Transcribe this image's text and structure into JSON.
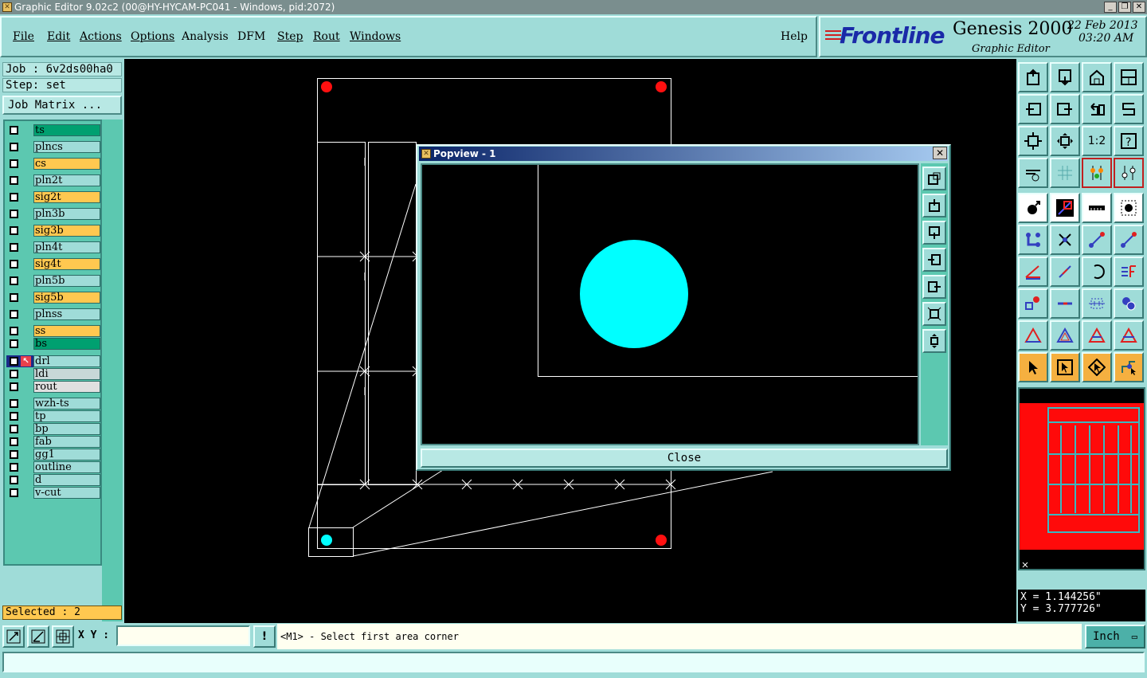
{
  "window": {
    "title": "Graphic Editor 9.02c2 (00@HY-HYCAM-PC041 - Windows, pid:2072)"
  },
  "menu": [
    "File",
    "Edit",
    "Actions",
    "Options",
    "Analysis",
    "DFM",
    "Step",
    "Rout",
    "Windows"
  ],
  "help": "Help",
  "brand": {
    "logo": "Frontline",
    "product": "Genesis 2000",
    "subtitle": "Graphic Editor",
    "date": "22 Feb 2013",
    "time": "03:20 AM"
  },
  "job": {
    "job_line": "Job : 6v2ds00ha0",
    "step_line": "Step: set",
    "matrix_button": "Job Matrix ..."
  },
  "layers": [
    {
      "name": "ts",
      "color": "#00a070"
    },
    {
      "name": "plncs",
      "color": "#9fdcd8"
    },
    {
      "name": "cs",
      "color": "#ffc850"
    },
    {
      "name": "pln2t",
      "color": "#9fdcd8"
    },
    {
      "name": "sig2t",
      "color": "#ffc850"
    },
    {
      "name": "pln3b",
      "color": "#9fdcd8"
    },
    {
      "name": "sig3b",
      "color": "#ffc850"
    },
    {
      "name": "pln4t",
      "color": "#9fdcd8"
    },
    {
      "name": "sig4t",
      "color": "#ffc850"
    },
    {
      "name": "pln5b",
      "color": "#9fdcd8"
    },
    {
      "name": "sig5b",
      "color": "#ffc850"
    },
    {
      "name": "plnss",
      "color": "#9fdcd8"
    },
    {
      "name": "ss",
      "color": "#ffc850"
    },
    {
      "name": "bs",
      "color": "#00a070"
    },
    {
      "name": "drl",
      "color": "#9fdcd8"
    },
    {
      "name": "ldi",
      "color": "#c8d8d8"
    },
    {
      "name": "rout",
      "color": "#e0e0e0"
    },
    {
      "name": "wzh-ts",
      "color": "#9fdcd8"
    },
    {
      "name": "tp",
      "color": "#9fdcd8"
    },
    {
      "name": "bp",
      "color": "#9fdcd8"
    },
    {
      "name": "fab",
      "color": "#9fdcd8"
    },
    {
      "name": "gg1",
      "color": "#9fdcd8"
    },
    {
      "name": "outline",
      "color": "#9fdcd8"
    },
    {
      "name": "d",
      "color": "#9fdcd8"
    },
    {
      "name": "v-cut",
      "color": "#9fdcd8"
    }
  ],
  "selected": "Selected : 2",
  "popview": {
    "title": "Popview - 1",
    "close_label": "Close"
  },
  "coords": {
    "x": "X = 1.144256\"",
    "y": "Y = 3.777726\""
  },
  "bottom": {
    "xy_label": "X Y :",
    "xy_value": "",
    "prompt": "<M1> - Select first area corner",
    "unit": "Inch"
  },
  "zoom_ratio_label": "1:2"
}
